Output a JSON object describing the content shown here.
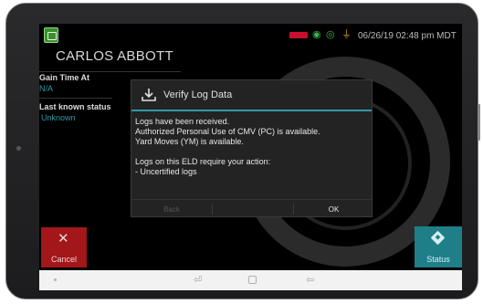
{
  "status_bar": {
    "datetime": "06/26/19 02:48 pm MDT",
    "icons": [
      "app-logo-icon",
      "battery-low-icon",
      "gps-icon",
      "network-icon",
      "power-plug-icon"
    ],
    "colors": {
      "battery": "#c8102e",
      "gps": "#39b54a",
      "power": "#d4a017"
    }
  },
  "driver": {
    "name": "CARLOS ABBOTT",
    "gain_time_label": "Gain Time At",
    "gain_time_value": "N/A",
    "last_status_label": "Last known status",
    "last_status_value": "Unknown"
  },
  "dialog": {
    "title": "Verify Log Data",
    "icon": "download-icon",
    "lines": [
      "Logs have been received.",
      "Authorized Personal Use of CMV (PC) is available.",
      "Yard Moves (YM) is available.",
      "",
      "Logs on this ELD require your action:",
      "- Uncertified logs"
    ],
    "back_label": "Back",
    "ok_label": "OK",
    "accent_color": "#2e9aa6"
  },
  "bottom_buttons": {
    "cancel_label": "Cancel",
    "cancel_color": "#a3161a",
    "status_label": "Status",
    "status_color": "#1e7f89"
  },
  "nav_bar": {
    "recent_glyph": "⏎",
    "back_glyph": "⇦"
  }
}
